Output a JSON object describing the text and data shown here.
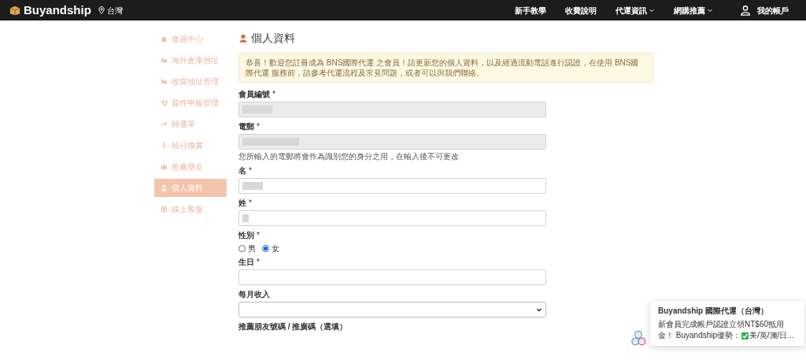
{
  "navbar": {
    "logo": "Buyandship",
    "region": "台灣",
    "links": [
      {
        "label": "新手教學",
        "dropdown": false
      },
      {
        "label": "收費說明",
        "dropdown": false
      },
      {
        "label": "代運資訊",
        "dropdown": true
      },
      {
        "label": "網購推薦",
        "dropdown": true
      }
    ],
    "account": "我的帳戶"
  },
  "sidebar": {
    "items": [
      {
        "label": "會員中心",
        "selected": false
      },
      {
        "label": "海外倉庫地址",
        "selected": false
      },
      {
        "label": "收貨地址管理",
        "selected": false
      },
      {
        "label": "貨件申報管理",
        "selected": false
      },
      {
        "label": "轉運單",
        "selected": false
      },
      {
        "label": "積分換賞",
        "selected": false
      },
      {
        "label": "推薦朋友",
        "selected": false
      },
      {
        "label": "個人資料",
        "selected": true
      },
      {
        "label": "線上客服",
        "selected": false
      }
    ]
  },
  "page": {
    "title": "個人資料",
    "alert": "恭喜！歡迎您註冊成為 BNS國際代運 之會員！請更新您的個人資料，以及經過流動電話進行認證，在使用 BNS國際代運 服務前，請參考代運流程及常見問題，或者可以與我們聯絡。",
    "fields": [
      {
        "kind": "text",
        "label": "會員編號",
        "required_mark": "*",
        "disabled": true,
        "redacted": true
      },
      {
        "kind": "text",
        "label": "電郵",
        "required_mark": "*",
        "disabled": true,
        "redacted": true,
        "help": "您所輸入的電郵將會作為識別您的身分之用，在輸入後不可更改"
      },
      {
        "kind": "text",
        "label": "名",
        "required_mark": "*",
        "disabled": false,
        "redacted": true
      },
      {
        "kind": "text",
        "label": "姓",
        "required_mark": "*",
        "disabled": false,
        "redacted": true
      },
      {
        "kind": "radio",
        "label": "性別",
        "required_mark": "*",
        "options": [
          {
            "label": "男",
            "selected": false
          },
          {
            "label": "女",
            "selected": true
          }
        ]
      },
      {
        "kind": "text",
        "label": "生日",
        "required_mark": "*",
        "disabled": false,
        "redacted": false
      },
      {
        "kind": "select",
        "label": "每月收入"
      },
      {
        "kind": "label",
        "label": "推薦朋友號碼 / 推廣碼（選填）"
      }
    ]
  },
  "chat_popup": {
    "title": "Buyandship 國際代運（台灣）",
    "message_line_1": "新會員完成帳戶認證立領NT$60抵用",
    "message_line_2_start": "金！ Buyandship優勢：",
    "message_line_2_end": "美/英/澳/日..."
  }
}
